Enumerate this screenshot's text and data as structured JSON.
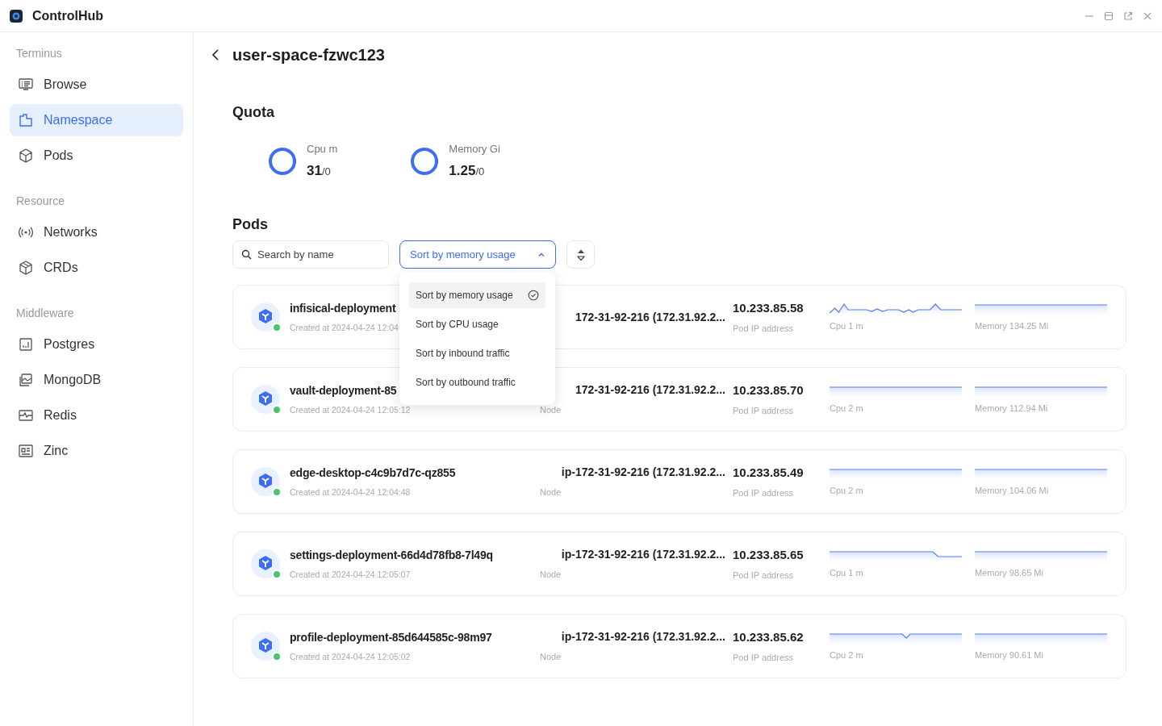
{
  "window": {
    "title": "ControlHub"
  },
  "sidebar": {
    "sections": [
      {
        "title": "Terminus",
        "items": [
          {
            "label": "Browse",
            "selected": false
          },
          {
            "label": "Namespace",
            "selected": true
          },
          {
            "label": "Pods",
            "selected": false
          }
        ]
      },
      {
        "title": "Resource",
        "items": [
          {
            "label": "Networks",
            "selected": false
          },
          {
            "label": "CRDs",
            "selected": false
          }
        ]
      },
      {
        "title": "Middleware",
        "items": [
          {
            "label": "Postgres",
            "selected": false
          },
          {
            "label": "MongoDB",
            "selected": false
          },
          {
            "label": "Redis",
            "selected": false
          },
          {
            "label": "Zinc",
            "selected": false
          }
        ]
      }
    ]
  },
  "header": {
    "title": "user-space-fzwc123"
  },
  "quota": {
    "title": "Quota",
    "items": [
      {
        "label": "Cpu m",
        "value": "31",
        "limit": "/0"
      },
      {
        "label": "Memory Gi",
        "value": "1.25",
        "limit": "/0"
      }
    ]
  },
  "pods": {
    "title": "Pods",
    "search": {
      "placeholder": "Search by name"
    },
    "sort": {
      "value": "Sort by memory usage",
      "expanded": true
    },
    "sort_options": [
      {
        "label": "Sort by memory usage",
        "selected": true
      },
      {
        "label": "Sort by CPU usage",
        "selected": false
      },
      {
        "label": "Sort by inbound traffic",
        "selected": false
      },
      {
        "label": "Sort by outbound traffic",
        "selected": false
      }
    ],
    "rows": [
      {
        "name": "infisical-deployment",
        "created": "Created at 2024-04-24 12:04",
        "node": "172-31-92-216 (172.31.92.2...",
        "node_label": "",
        "ip": "10.233.85.58",
        "ip_label": "Pod IP address",
        "cpu": "Cpu 1 m",
        "memory": "Memory 134.25 Mi",
        "color": "#4cc36d"
      },
      {
        "name": "vault-deployment-85",
        "created": "Created at 2024-04-24 12:05:12",
        "node": "172-31-92-216 (172.31.92.2...",
        "node_label": "Node",
        "ip": "10.233.85.70",
        "ip_label": "Pod IP address",
        "cpu": "Cpu 2 m",
        "memory": "Memory 112.94 Mi",
        "color": "#4cc36d"
      },
      {
        "name": "edge-desktop-c4c9b7d7c-qz855",
        "created": "Created at 2024-04-24 12:04:48",
        "node": "ip-172-31-92-216 (172.31.92.2...",
        "node_label": "Node",
        "ip": "10.233.85.49",
        "ip_label": "Pod IP address",
        "cpu": "Cpu 2 m",
        "memory": "Memory 104.06 Mi",
        "color": "#4cc36d"
      },
      {
        "name": "settings-deployment-66d4d78fb8-7l49q",
        "created": "Created at 2024-04-24 12:05:07",
        "node": "ip-172-31-92-216 (172.31.92.2...",
        "node_label": "Node",
        "ip": "10.233.85.65",
        "ip_label": "Pod IP address",
        "cpu": "Cpu 1 m",
        "memory": "Memory 98.65 Mi",
        "color": "#4cc36d"
      },
      {
        "name": "profile-deployment-85d644585c-98m97",
        "created": "Created at 2024-04-24 12:05:02",
        "node": "ip-172-31-92-216 (172.31.92.2...",
        "node_label": "Node",
        "ip": "10.233.85.62",
        "ip_label": "Pod IP address",
        "cpu": "Cpu 2 m",
        "memory": "Memory 90.61 Mi",
        "color": "#4cc36d"
      }
    ]
  }
}
